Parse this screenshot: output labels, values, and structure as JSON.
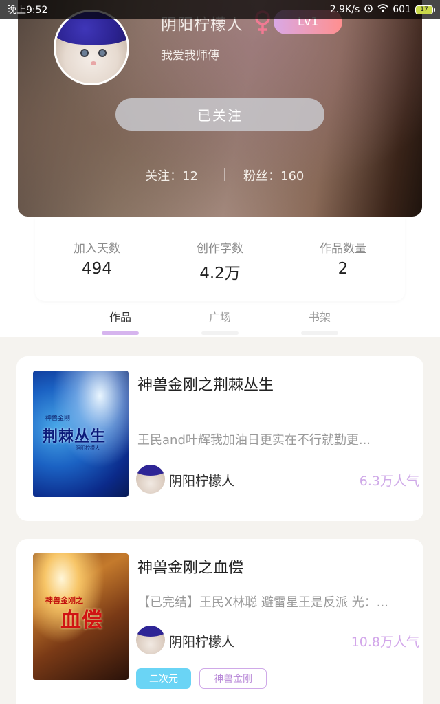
{
  "status_bar": {
    "time": "晚上9:52",
    "speed": "2.9K/s",
    "signal": "601",
    "battery": "17"
  },
  "profile": {
    "username": "阴阳柠檬人",
    "gender_icon": "female-symbol-icon",
    "level": "Lv1",
    "bio": "我爱我师傅",
    "follow_button": "已关注",
    "following": "关注：12",
    "fans": "粉丝：160"
  },
  "stats": [
    {
      "label": "加入天数",
      "value": "494"
    },
    {
      "label": "创作字数",
      "value": "4.2万"
    },
    {
      "label": "作品数量",
      "value": "2"
    }
  ],
  "tabs": [
    {
      "label": "作品",
      "active": true
    },
    {
      "label": "广场",
      "active": false
    },
    {
      "label": "书架",
      "active": false
    }
  ],
  "works": [
    {
      "title": "神兽金刚之荆棘丛生",
      "description": "王民and叶辉我加油日更实在不行就勤更...",
      "author": "阴阳柠檬人",
      "popularity": "6.3万人气",
      "cover": {
        "sub": "神兽金刚",
        "title": "荆棘丛生",
        "author": "阴阳柠檬人"
      }
    },
    {
      "title": "神兽金刚之血偿",
      "description": "【已完结】王民X林聪 避雷星王是反派 光：...",
      "author": "阴阳柠檬人",
      "popularity": "10.8万人气",
      "cover": {
        "sub": "神兽金刚之",
        "title": "血偿"
      },
      "tags": [
        "二次元",
        "神兽金刚"
      ]
    }
  ],
  "colors": {
    "accent_purple": "#cfa9e8",
    "tag_cyan": "#6ad4f5",
    "level_gradient_start": "#d9a8e6",
    "level_gradient_end": "#ff8f8f",
    "gender_pink": "#f07a93"
  }
}
